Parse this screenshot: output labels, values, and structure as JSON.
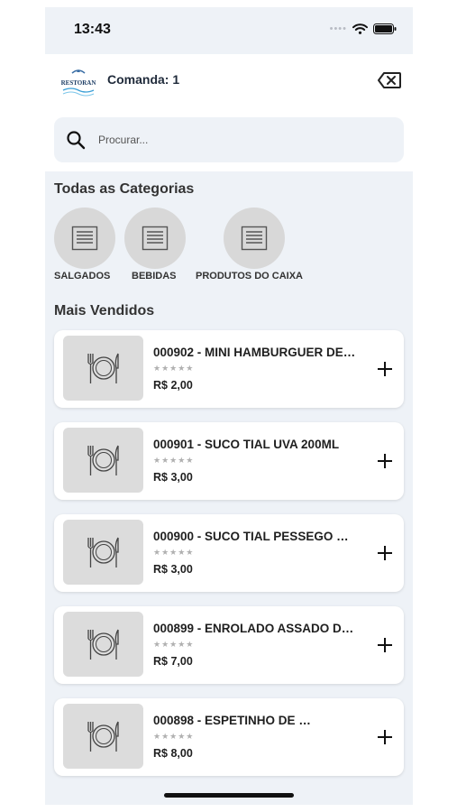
{
  "status_bar": {
    "time": "13:43"
  },
  "header": {
    "logo_text": "RESTORAN",
    "title": "Comanda: 1"
  },
  "search": {
    "placeholder": "Procurar..."
  },
  "categories_section": {
    "title": "Todas as Categorias",
    "items": [
      {
        "label": "SALGADOS"
      },
      {
        "label": "BEBIDAS"
      },
      {
        "label": "PRODUTOS DO CAIXA"
      }
    ]
  },
  "best_sellers": {
    "title": "Mais Vendidos",
    "items": [
      {
        "name": "000902 - MINI HAMBURGUER DE…",
        "stars": "★★★★★",
        "price": "R$ 2,00"
      },
      {
        "name": "000901 - SUCO TIAL UVA 200ML",
        "stars": "★★★★★",
        "price": "R$ 3,00"
      },
      {
        "name": "000900 - SUCO TIAL PESSEGO …",
        "stars": "★★★★★",
        "price": "R$ 3,00"
      },
      {
        "name": "000899 - ENROLADO ASSADO D…",
        "stars": "★★★★★",
        "price": "R$ 7,00"
      },
      {
        "name": "000898 - ESPETINHO DE …",
        "stars": "★★★★★",
        "price": "R$ 8,00"
      }
    ]
  },
  "colors": {
    "background": "#eef2f7",
    "card": "#ffffff",
    "placeholder_gray": "#d8d8d8"
  },
  "icons": {
    "search": "search-icon",
    "back": "backspace-icon",
    "category": "document-list-icon",
    "product": "plate-cutlery-icon",
    "add": "plus-icon"
  }
}
